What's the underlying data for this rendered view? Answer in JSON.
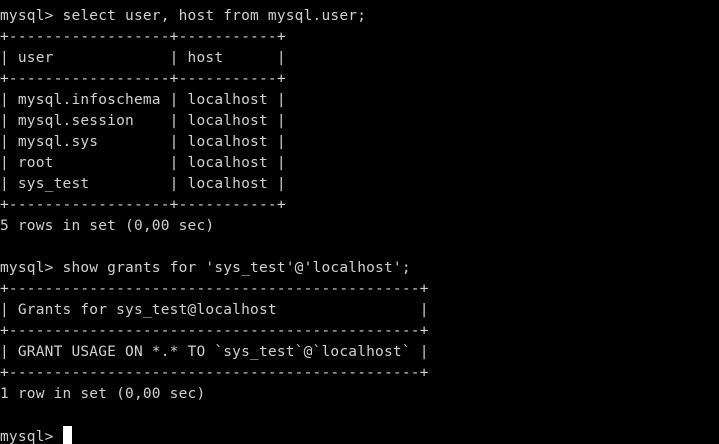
{
  "terminal": {
    "lines": [
      "mysql> select user, host from mysql.user;",
      "+------------------+-----------+",
      "| user             | host      |",
      "+------------------+-----------+",
      "| mysql.infoschema | localhost |",
      "| mysql.session    | localhost |",
      "| mysql.sys        | localhost |",
      "| root             | localhost |",
      "| sys_test         | localhost |",
      "+------------------+-----------+",
      "5 rows in set (0,00 sec)",
      "",
      "mysql> show grants for 'sys_test'@'localhost';",
      "+----------------------------------------------+",
      "| Grants for sys_test@localhost                |",
      "+----------------------------------------------+",
      "| GRANT USAGE ON *.* TO `sys_test`@`localhost` |",
      "+----------------------------------------------+",
      "1 row in set (0,00 sec)",
      ""
    ],
    "prompt": "mysql> ",
    "colors": {
      "background": "#000000",
      "foreground": "#d0d0d0",
      "cursor": "#ffffff"
    }
  }
}
